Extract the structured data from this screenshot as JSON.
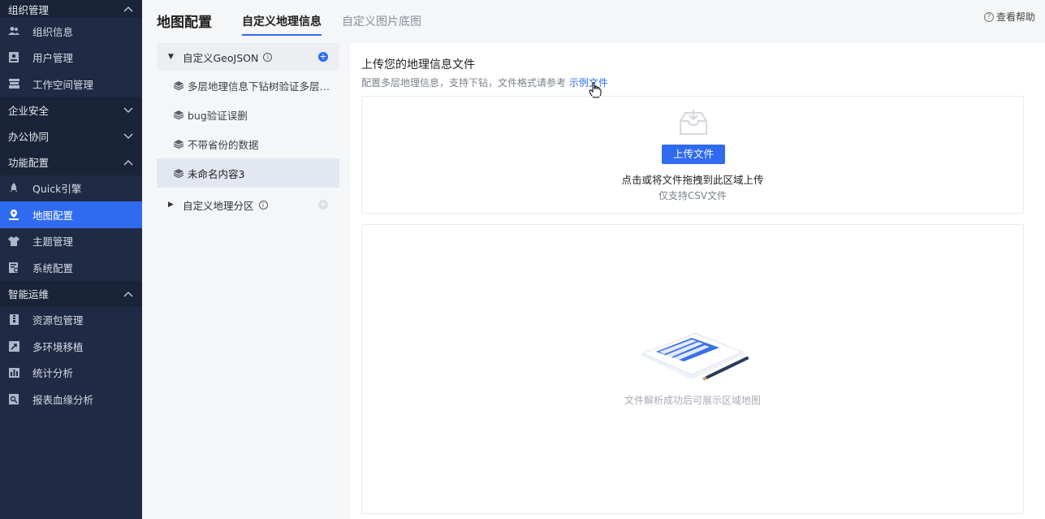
{
  "sidebar": {
    "groups": [
      {
        "title": "组织管理",
        "expanded": true,
        "items": [
          {
            "label": "组织信息",
            "icon": "users-icon"
          },
          {
            "label": "用户管理",
            "icon": "user-card-icon"
          },
          {
            "label": "工作空间管理",
            "icon": "workspace-icon"
          }
        ]
      },
      {
        "title": "企业安全",
        "expanded": false,
        "items": []
      },
      {
        "title": "办公协同",
        "expanded": false,
        "items": []
      },
      {
        "title": "功能配置",
        "expanded": true,
        "items": [
          {
            "label": "Quick引擎",
            "icon": "rocket-icon"
          },
          {
            "label": "地图配置",
            "icon": "map-pin-icon",
            "active": true
          },
          {
            "label": "主题管理",
            "icon": "shirt-icon"
          },
          {
            "label": "系统配置",
            "icon": "settings-doc-icon"
          }
        ]
      },
      {
        "title": "智能运维",
        "expanded": true,
        "items": [
          {
            "label": "资源包管理",
            "icon": "package-icon"
          },
          {
            "label": "多环境移植",
            "icon": "migrate-icon"
          },
          {
            "label": "统计分析",
            "icon": "bar-chart-icon"
          },
          {
            "label": "报表血缘分析",
            "icon": "report-lineage-icon"
          }
        ]
      }
    ]
  },
  "header": {
    "title": "地图配置",
    "tabs": [
      {
        "label": "自定义地理信息",
        "active": true
      },
      {
        "label": "自定义图片底图",
        "active": false
      }
    ],
    "help": "查看帮助"
  },
  "tree": {
    "group1": {
      "label": "自定义GeoJSON",
      "expanded": true
    },
    "items": [
      {
        "label": "多层地理信息下钻树验证多层…"
      },
      {
        "label": "bug验证误删"
      },
      {
        "label": "不带省份的数据"
      },
      {
        "label": "未命名内容3",
        "selected": true
      }
    ],
    "group2": {
      "label": "自定义地理分区",
      "expanded": false
    }
  },
  "main": {
    "upload_title": "上传您的地理信息文件",
    "upload_desc": "配置多层地理信息，支持下钻，文件格式请参考",
    "sample_link": "示例文件",
    "upload_button": "上传文件",
    "drop_text": "点击或将文件拖拽到此区域上传",
    "drop_sub": "仅支持CSV文件",
    "preview_text": "文件解析成功后可展示区域地图"
  },
  "colors": {
    "accent": "#2f6bf0",
    "sidebar_bg": "#1f2a44"
  }
}
